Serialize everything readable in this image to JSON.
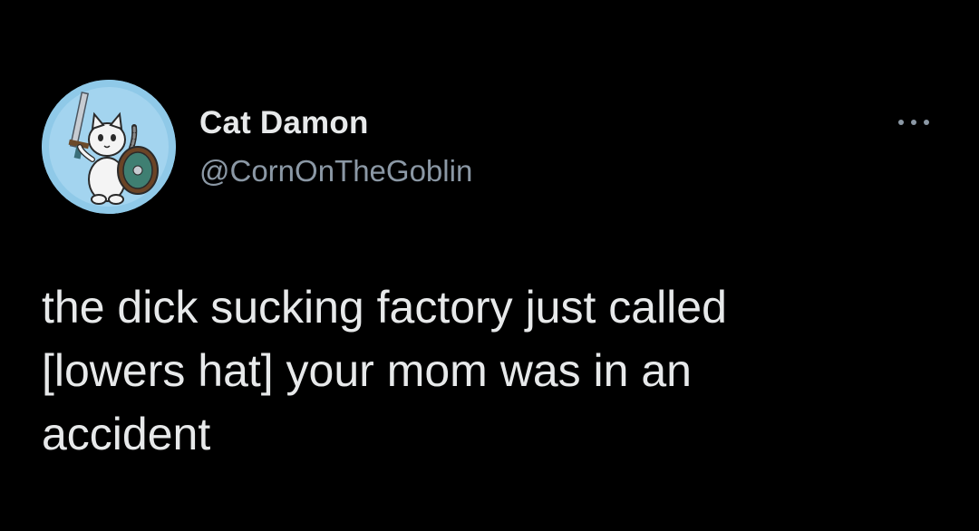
{
  "author": {
    "display_name": "Cat Damon",
    "handle": "@CornOnTheGoblin",
    "avatar_icon": "cat-warrior-avatar"
  },
  "menu": {
    "icon": "more-options-icon"
  },
  "tweet": {
    "lines": [
      "the dick sucking factory just called",
      "[lowers hat] your mom was in an",
      "accident"
    ]
  },
  "colors": {
    "background": "#000000",
    "text_primary": "#e7e9ea",
    "text_secondary": "#8b98a5",
    "avatar_bg": "#8fc9e8"
  }
}
